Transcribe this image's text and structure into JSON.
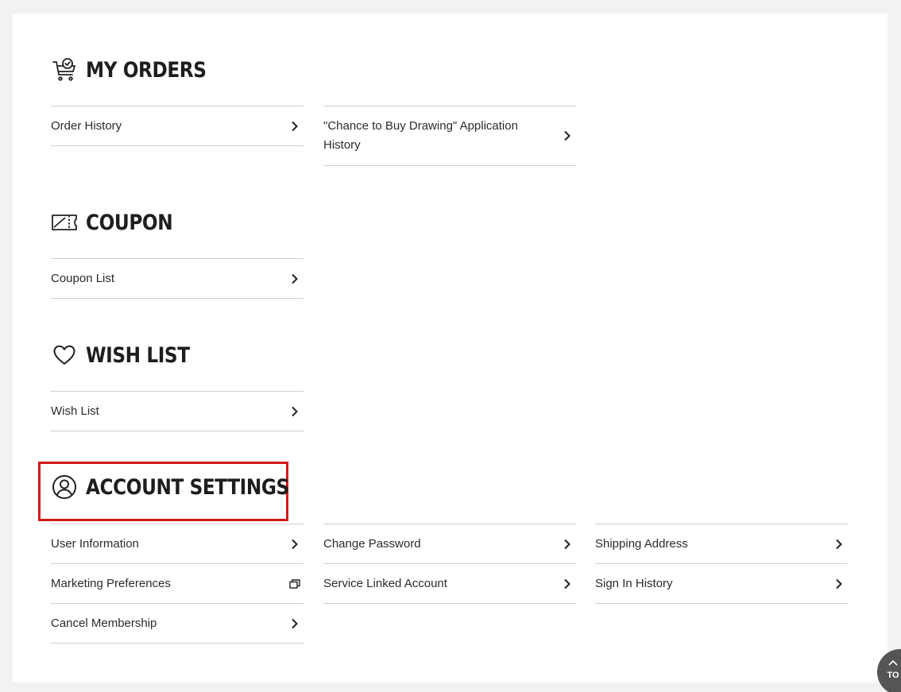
{
  "sections": {
    "my_orders": {
      "title": "MY ORDERS",
      "icon": "shopping-cart-check-icon",
      "items": [
        {
          "label": "Order History"
        },
        {
          "label": "\"Chance to Buy Drawing\" Application History"
        }
      ]
    },
    "coupon": {
      "title": "COUPON",
      "icon": "coupon-ticket-icon",
      "items": [
        {
          "label": "Coupon List"
        }
      ]
    },
    "wish_list": {
      "title": "WISH LIST",
      "icon": "heart-icon",
      "items": [
        {
          "label": "Wish List"
        }
      ]
    },
    "account_settings": {
      "title": "ACCOUNT SETTINGS",
      "icon": "user-circle-icon",
      "items": [
        {
          "label": "User Information"
        },
        {
          "label": "Change Password"
        },
        {
          "label": "Shipping Address"
        },
        {
          "label": "Marketing Preferences",
          "icon": "external-window-icon"
        },
        {
          "label": "Service Linked Account"
        },
        {
          "label": "Sign In History"
        },
        {
          "label": "Cancel Membership"
        }
      ]
    }
  },
  "back_to_top": {
    "label": "TO",
    "icon": "chevron-up-icon"
  },
  "colors": {
    "highlight": "#d21919",
    "text": "#2b2b2b",
    "divider": "#cfcfcf",
    "top_button": "#555555"
  }
}
